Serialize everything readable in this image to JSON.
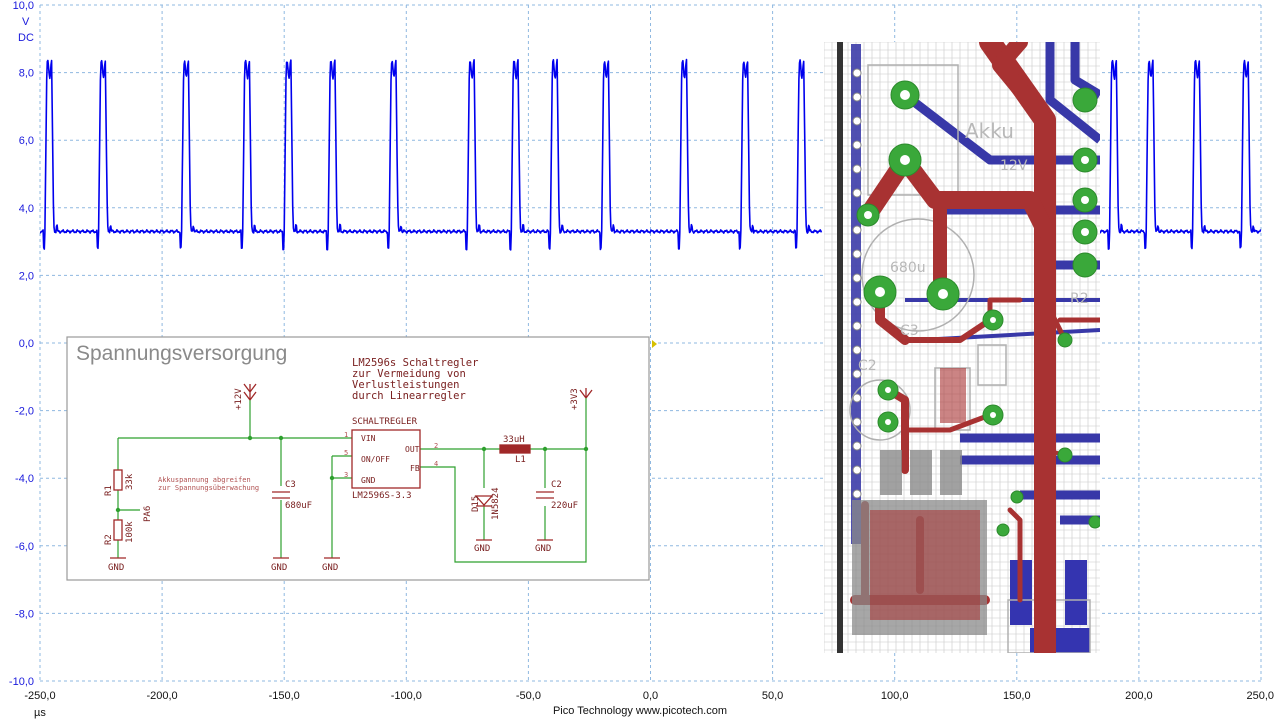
{
  "scope": {
    "y_axis": {
      "unit": "V",
      "coupling": "DC",
      "ticks": [
        "10,0",
        "8,0",
        "6,0",
        "4,0",
        "2,0",
        "0,0",
        "-2,0",
        "-4,0",
        "-6,0",
        "-8,0",
        "-10,0"
      ]
    },
    "x_axis": {
      "unit": "µs",
      "ticks": [
        "-250,0",
        "-200,0",
        "-150,0",
        "-100,0",
        "-50,0",
        "0,0",
        "50,0",
        "100,0",
        "150,0",
        "200,0",
        "250,0"
      ]
    },
    "footer": "Pico Technology  www.picotech.com",
    "trace_color": "#0000ee",
    "grid_color": "#8fb8e0",
    "trace": {
      "baseline_v": 3.3,
      "peak_v": 8.1,
      "x_range_us": [
        -250,
        70
      ],
      "x_range2_us": [
        182,
        250
      ],
      "pulse_starts_us": [
        -248,
        -226,
        -192,
        -167,
        -150,
        -132,
        -107,
        -75,
        -57,
        -41,
        -20,
        12,
        37,
        60,
        188,
        203,
        222,
        242
      ]
    }
  },
  "schematic": {
    "title": "Spannungsversorgung",
    "note_lines": [
      "LM2596s Schaltregler",
      "zur Vermeidung von",
      "Verlustleistungen",
      "durch Linearregler"
    ],
    "ic": {
      "name": "SCHALTREGLER",
      "part": "LM2596S-3.3",
      "pins": [
        "VIN",
        "ON/OFF",
        "GND",
        "OUT",
        "FB"
      ],
      "pin_numbers": [
        "1",
        "5",
        "3",
        "2",
        "4"
      ]
    },
    "supplies": [
      "+12V",
      "+3V3"
    ],
    "r1": {
      "ref": "R1",
      "value": "33k"
    },
    "r2": {
      "ref": "R2",
      "value": "100k"
    },
    "net_pa6": "PA6",
    "c3": {
      "ref": "C3",
      "value": "680uF"
    },
    "c2": {
      "ref": "C2",
      "value": "220uF"
    },
    "l1": {
      "ref": "L1",
      "value": "33uH"
    },
    "d15": {
      "ref": "D15",
      "value": "1N5824"
    },
    "gnd": "GND",
    "comment_lines": [
      "Akkuspannung abgreifen",
      "zur Spannungsüberwachung"
    ]
  },
  "pcb": {
    "labels": [
      "Akku",
      "12V",
      "680u",
      "C3",
      "C2",
      "R2"
    ],
    "colors": {
      "top": "#a83232",
      "bottom": "#2c2ca6",
      "pad": "#3aa83a",
      "grid": "#c8c8c8",
      "silk": "#b8b8b8"
    }
  }
}
